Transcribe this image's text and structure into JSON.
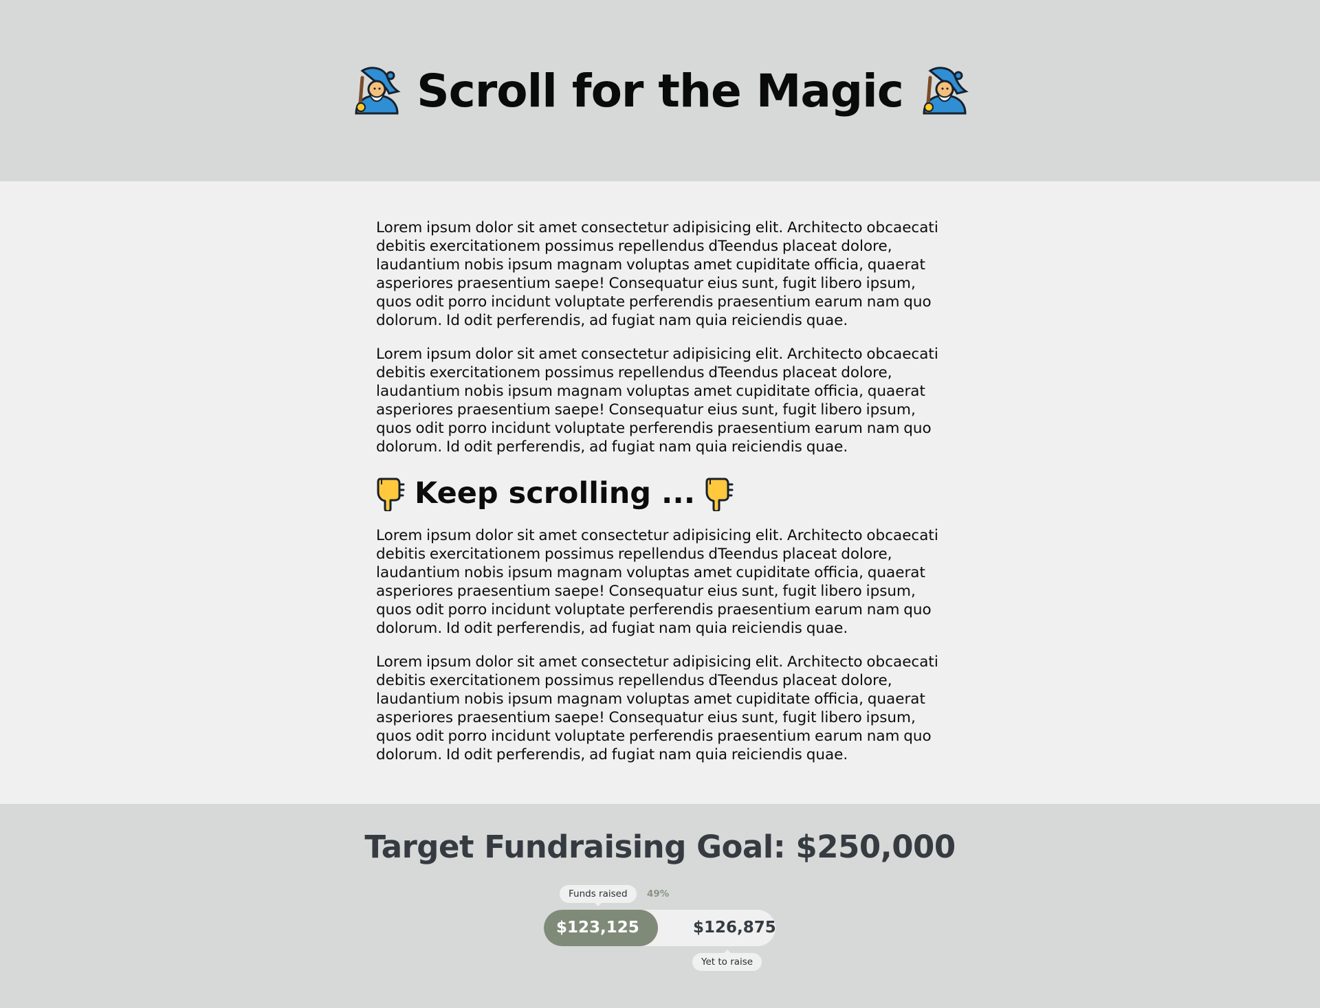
{
  "header": {
    "title": "Scroll for the Magic",
    "left_icon": "mage-emoji-icon",
    "right_icon": "mage-emoji-icon"
  },
  "content": {
    "paragraphs_top": [
      "Lorem ipsum dolor sit amet consectetur adipisicing elit. Architecto obcaecati debitis exercitationem possimus repellendus dTeendus placeat dolore, laudantium nobis ipsum magnam voluptas amet cupiditate officia, quaerat asperiores praesentium saepe! Consequatur eius sunt, fugit libero ipsum, quos odit porro incidunt voluptate perferendis praesentium earum nam quo dolorum. Id odit perferendis, ad fugiat nam quia reiciendis quae.",
      "Lorem ipsum dolor sit amet consectetur adipisicing elit. Architecto obcaecati debitis exercitationem possimus repellendus dTeendus placeat dolore, laudantium nobis ipsum magnam voluptas amet cupiditate officia, quaerat asperiores praesentium saepe! Consequatur eius sunt, fugit libero ipsum, quos odit porro incidunt voluptate perferendis praesentium earum nam quo dolorum. Id odit perferendis, ad fugiat nam quia reiciendis quae."
    ],
    "subheading": "Keep scrolling ...",
    "subheading_icon": "backhand-index-pointing-down-icon",
    "paragraphs_bottom": [
      "Lorem ipsum dolor sit amet consectetur adipisicing elit. Architecto obcaecati debitis exercitationem possimus repellendus dTeendus placeat dolore, laudantium nobis ipsum magnam voluptas amet cupiditate officia, quaerat asperiores praesentium saepe! Consequatur eius sunt, fugit libero ipsum, quos odit porro incidunt voluptate perferendis praesentium earum nam quo dolorum. Id odit perferendis, ad fugiat nam quia reiciendis quae.",
      "Lorem ipsum dolor sit amet consectetur adipisicing elit. Architecto obcaecati debitis exercitationem possimus repellendus dTeendus placeat dolore, laudantium nobis ipsum magnam voluptas amet cupiditate officia, quaerat asperiores praesentium saepe! Consequatur eius sunt, fugit libero ipsum, quos odit porro incidunt voluptate perferendis praesentium earum nam quo dolorum. Id odit perferendis, ad fugiat nam quia reiciendis quae."
    ]
  },
  "fundraising": {
    "title": "Target Fundraising Goal: $250,000",
    "raised_tag": "Funds raised",
    "percent_label": "49%",
    "progress_fraction": 0.4925,
    "raised_amount": "$123,125",
    "remaining_amount": "$126,875",
    "remaining_tag": "Yet to raise"
  },
  "colors": {
    "header_bg": "#d6d9d8",
    "content_bg": "#f0f0f0",
    "progress_fill": "#7f8b78",
    "heading_dark": "#353b40"
  }
}
